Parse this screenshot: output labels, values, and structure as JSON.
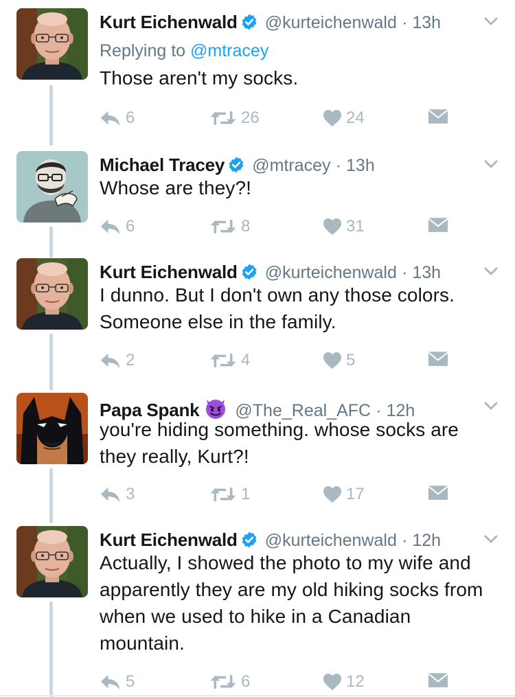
{
  "colors": {
    "text": "#14171a",
    "secondary": "#657786",
    "link": "#1da1f2",
    "action": "#aab8c2",
    "verified": "#1da1f2",
    "thread": "#ccd6dd"
  },
  "tweets": [
    {
      "name": "Kurt Eichenwald",
      "verified": true,
      "handle": "@kurteichenwald",
      "time": "· 13h",
      "reply_prefix": "Replying to ",
      "reply_handle": "@mtracey",
      "text": "Those aren't my socks.",
      "replies": "6",
      "retweets": "26",
      "likes": "24",
      "avatar": "kurt-avatar"
    },
    {
      "name": "Michael Tracey",
      "verified": true,
      "handle": "@mtracey",
      "time": "· 13h",
      "text": "Whose are they?!",
      "replies": "6",
      "retweets": "8",
      "likes": "31",
      "avatar": "tracey-avatar"
    },
    {
      "name": "Kurt Eichenwald",
      "verified": true,
      "handle": "@kurteichenwald",
      "time": "· 13h",
      "text": "I dunno. But I don't own any those colors. Someone else in the family.",
      "replies": "2",
      "retweets": "4",
      "likes": "5",
      "avatar": "kurt-avatar"
    },
    {
      "name": "Papa Spank",
      "emoji": "smiling-devil-emoji",
      "handle": "@The_Real_AFC",
      "time": "· 12h",
      "text": "you're hiding something. whose socks are they really, Kurt?!",
      "replies": "3",
      "retweets": "1",
      "likes": "17",
      "avatar": "batman-avatar"
    },
    {
      "name": "Kurt Eichenwald",
      "verified": true,
      "handle": "@kurteichenwald",
      "time": "· 12h",
      "text": "Actually, I showed the photo to my wife and apparently they are my old hiking socks from when we used to hike in a Canadian mountain.",
      "replies": "5",
      "retweets": "6",
      "likes": "12",
      "avatar": "kurt-avatar"
    }
  ]
}
